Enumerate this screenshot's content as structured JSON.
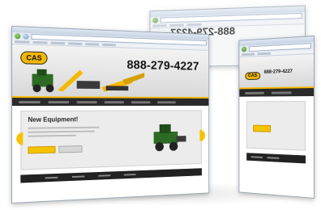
{
  "front_window": {
    "logo_text": "CAS",
    "phone": "888-279-4227",
    "hero_title": "New Equipment!"
  },
  "back_window": {
    "phone_mirrored": "888-279-4227"
  },
  "right_window": {
    "logo_text": "CAS",
    "phone": "888-279-4227"
  },
  "colors": {
    "accent_yellow": "#f5b800",
    "dark_nav": "#2a2a2a",
    "window_frame": "#9aa6b6"
  }
}
